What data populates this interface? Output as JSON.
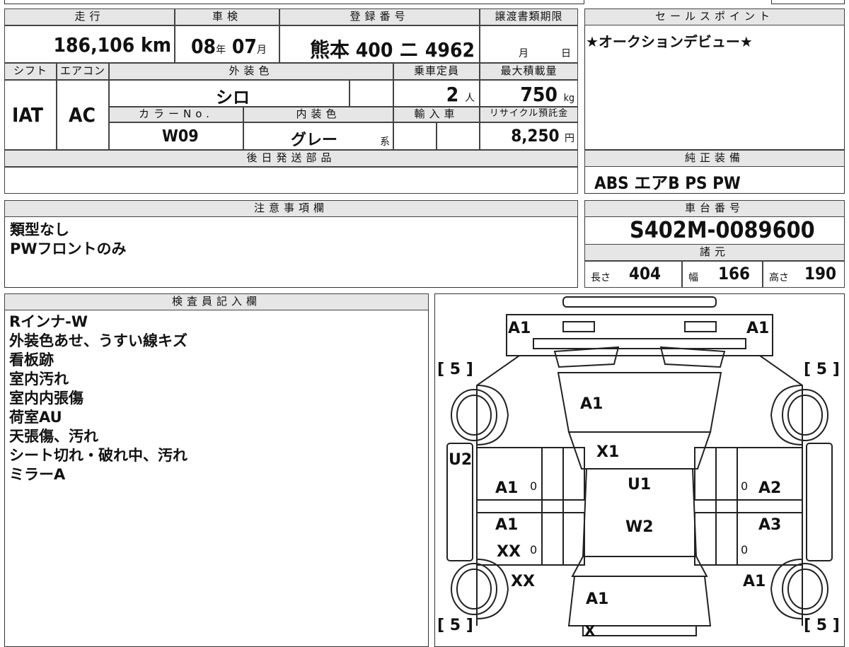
{
  "specs": {
    "mileage_label": "走行",
    "mileage_value": "186,106",
    "mileage_unit": "km",
    "inspection_label": "車検",
    "inspection_year": "08",
    "inspection_year_unit": "年",
    "inspection_month": "07",
    "inspection_month_unit": "月",
    "registration_label": "登録番号",
    "registration_value": "熊本 400 ニ 4962",
    "transfer_label": "譲渡書類期限",
    "transfer_month_unit": "月",
    "transfer_day_unit": "日",
    "shift_label": "シフト",
    "shift_value": "IAT",
    "aircon_label": "エアコン",
    "aircon_value": "AC",
    "exterior_label": "外装色",
    "exterior_value": "シロ",
    "capacity_label": "乗車定員",
    "capacity_value": "2",
    "capacity_unit": "人",
    "loadcap_label": "最大積載量",
    "loadcap_value": "750",
    "loadcap_unit": "kg",
    "color_no_label": "カラーNo.",
    "color_no_value": "W09",
    "interior_label": "内装色",
    "interior_value": "グレー",
    "interior_unit": "系",
    "import_label": "輸入車",
    "recycle_label": "リサイクル預託金",
    "recycle_value": "8,250",
    "recycle_unit": "円",
    "later_parts_label": "後日発送部品"
  },
  "sales_point": {
    "label": "セールスポイント",
    "text": "★オークションデビュー★"
  },
  "equipment": {
    "label": "純正装備",
    "text": "ABS エアB PS PW"
  },
  "notes": {
    "label": "注意事項欄",
    "lines": [
      "類型なし",
      "PWフロントのみ"
    ]
  },
  "chassis": {
    "label": "車台番号",
    "value": "S402M-0089600"
  },
  "dimensions": {
    "label": "諸元",
    "length_label": "長さ",
    "length_value": "404",
    "width_label": "幅",
    "width_value": "166",
    "height_label": "高さ",
    "height_value": "190"
  },
  "inspector": {
    "label": "検査員記入欄",
    "lines": [
      "Rインナ-W",
      "外装色あせ、うすい線キズ",
      "看板跡",
      "室内汚れ",
      "室内内張傷",
      "荷室AU",
      "天張傷、汚れ",
      "シート切れ・破れ中、汚れ",
      "ミラーA"
    ]
  },
  "diagram": {
    "marks": {
      "front_left": "A1",
      "front_right": "A1",
      "bonnet": "A1",
      "windshield": "X1",
      "roof_front": "U1",
      "roof_rear": "W2",
      "left_side": "U2",
      "left_front_door": "A1",
      "left_rear_door": "A1",
      "left_rear_door_2": "XX",
      "left_rear_quarter": "XX",
      "right_front_door": "A2",
      "right_rear_door": "A3",
      "right_rear_quarter": "A1",
      "rear_body": "A1",
      "rear_bottom": "X",
      "tire_fl": "5",
      "tire_fr": "5",
      "tire_rl": "5",
      "tire_rr": "5",
      "zero": "0"
    }
  }
}
